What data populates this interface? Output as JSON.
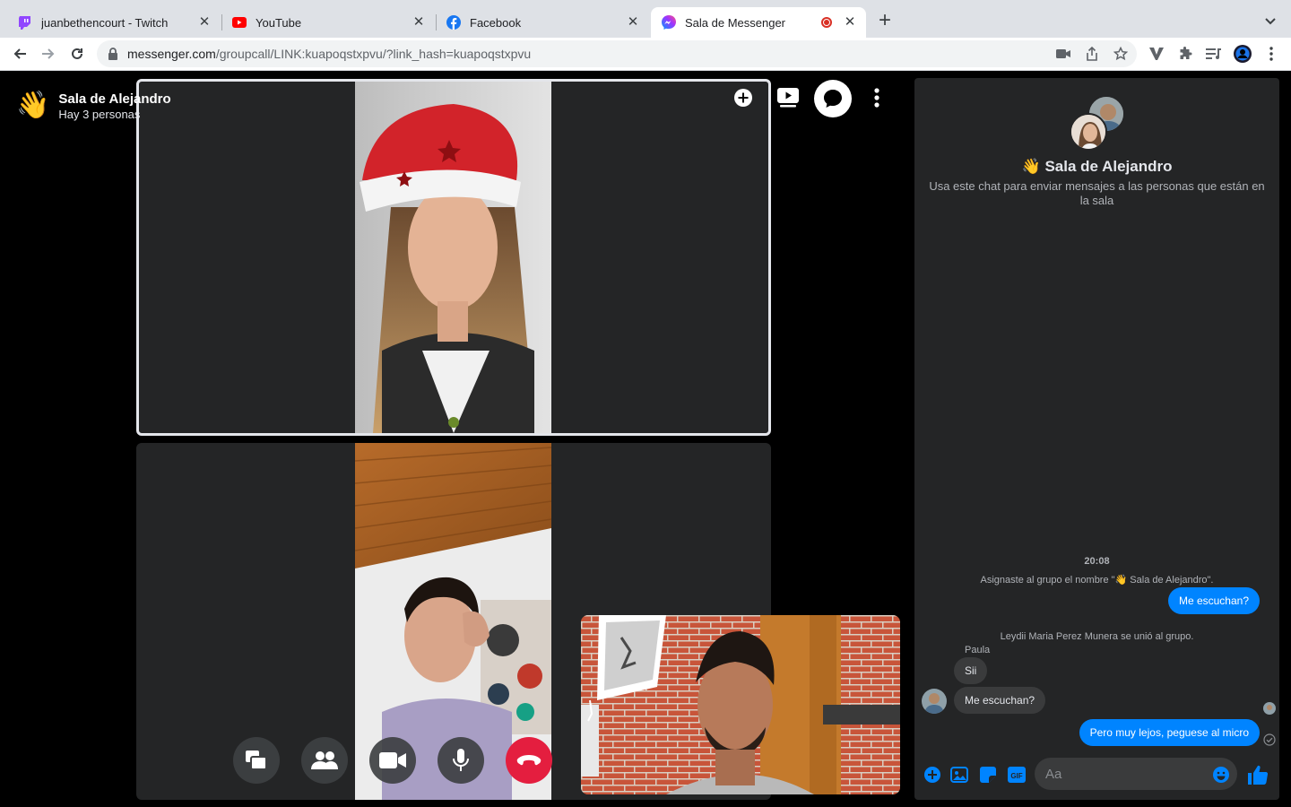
{
  "browser": {
    "tabs": [
      {
        "title": "juanbethencourt - Twitch",
        "icon": "twitch-icon",
        "color": "#9146ff"
      },
      {
        "title": "YouTube",
        "icon": "youtube-icon",
        "color": "#ff0000"
      },
      {
        "title": "Facebook",
        "icon": "facebook-icon",
        "color": "#1877f2"
      },
      {
        "title": "Sala de Messenger",
        "icon": "messenger-icon",
        "active": true,
        "recording": true
      }
    ],
    "url_host": "messenger.com",
    "url_path": "/groupcall/LINK:kuapoqstxpvu/?link_hash=kuapoqstxpvu"
  },
  "room": {
    "emoji": "👋",
    "title": "Sala de Alejandro",
    "subtitle": "Hay 3 personas"
  },
  "chat": {
    "title_emoji": "👋",
    "title": "Sala de Alejandro",
    "description": "Usa este chat para enviar mensajes a las personas que están en la sala",
    "timestamp": "20:08",
    "system_rename": "Asignaste al grupo el nombre \"👋 Sala de Alejandro\".",
    "msg_out_1": "Me escuchan?",
    "system_join": "Leydii Maria Perez Munera se unió al grupo.",
    "sender_name": "Paula",
    "msg_in_1": "Sii",
    "msg_in_2": "Me escuchan?",
    "msg_out_2": "Pero muy lejos, peguese al micro",
    "input_placeholder": "Aa"
  },
  "colors": {
    "accent": "#0084ff",
    "end_call": "#e41e3f",
    "panel": "#242526"
  }
}
